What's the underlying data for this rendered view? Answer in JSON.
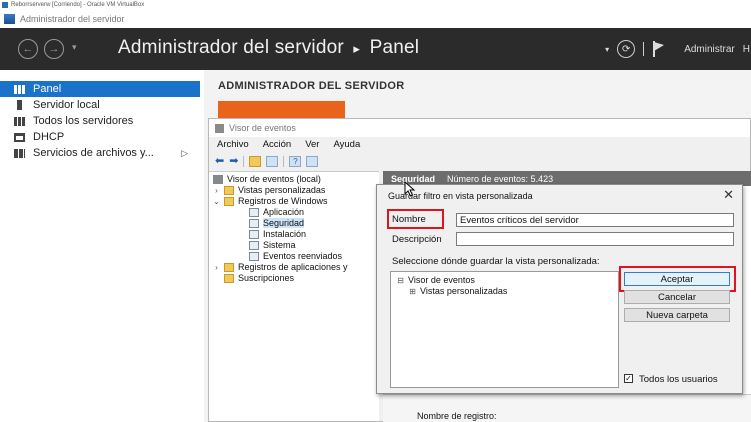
{
  "vbox": {
    "title": "Reborrserverw [Corriendo] - Oracle VM VirtualBox"
  },
  "server_manager": {
    "window_title": "Administrador del servidor",
    "breadcrumb_root": "Administrador del servidor",
    "breadcrumb_sep": "▸",
    "breadcrumb_page": "Panel",
    "manage_label": "Administrar",
    "extra_label": "H",
    "main_title": "ADMINISTRADOR DEL SERVIDOR"
  },
  "sidebar": {
    "items": [
      {
        "label": "Panel",
        "active": true
      },
      {
        "label": "Servidor local"
      },
      {
        "label": "Todos los servidores"
      },
      {
        "label": "DHCP"
      },
      {
        "label": "Servicios de archivos y..."
      }
    ]
  },
  "event_viewer": {
    "title": "Visor de eventos",
    "menu": [
      "Archivo",
      "Acción",
      "Ver",
      "Ayuda"
    ],
    "tree": [
      {
        "label": "Visor de eventos (local)"
      },
      {
        "label": "Vistas personalizadas"
      },
      {
        "label": "Registros de Windows"
      },
      {
        "label": "Aplicación"
      },
      {
        "label": "Seguridad"
      },
      {
        "label": "Instalación"
      },
      {
        "label": "Sistema"
      },
      {
        "label": "Eventos reenviados"
      },
      {
        "label": "Registros de aplicaciones y"
      },
      {
        "label": "Suscripciones"
      }
    ],
    "header_log": "Seguridad",
    "header_count": "Número de eventos: 5.423",
    "registry_label": "Nombre de registro:"
  },
  "dialog": {
    "title": "Guardar filtro en vista personalizada",
    "name_label": "Nombre",
    "name_value": "Eventos críticos del servidor",
    "description_label": "Descripción",
    "description_value": "",
    "location_label": "Seleccione dónde guardar la vista personalizada:",
    "tree_root": "Visor de eventos",
    "tree_child": "Vistas personalizadas",
    "accept_label": "Aceptar",
    "cancel_label": "Cancelar",
    "new_folder_label": "Nueva carpeta",
    "all_users_label": "Todos los usuarios",
    "all_users_checked": true
  },
  "colors": {
    "accent": "#1a73c9",
    "highlight": "#e0141e",
    "header_bg": "#2b2b2b",
    "tile": "#e8641b"
  }
}
